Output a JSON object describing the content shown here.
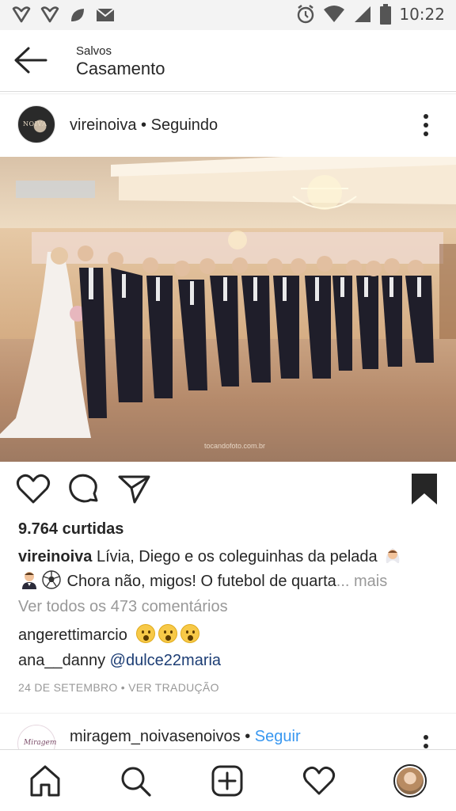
{
  "status_bar": {
    "time": "10:22",
    "left_icons": [
      "heart-outline-icon",
      "heart-outline-icon",
      "leaf-icon",
      "message-icon"
    ],
    "right_icons": [
      "alarm-icon",
      "wifi-icon",
      "signal-icon",
      "battery-icon"
    ]
  },
  "header": {
    "subtitle": "Salvos",
    "title": "Casamento"
  },
  "post": {
    "avatar_text": "NOIVA",
    "username": "vireinoiva",
    "separator": " • ",
    "follow_state": "Seguindo",
    "photo_credit": "tocandofoto.com.br",
    "likes": "9.764 curtidas",
    "caption_user": "vireinoiva",
    "caption_text_1": " Lívia, Diego e os coleguinhas da pelada ",
    "caption_text_2": " Chora não, migos! O futebol de quarta",
    "caption_more": "... mais",
    "view_all_comments": "Ver todos os 473 comentários",
    "comments": [
      {
        "user": "angerettimarcio",
        "text": ""
      },
      {
        "user": "ana__danny",
        "text": "@dulce22maria"
      }
    ],
    "date": "24 DE SETEMBRO",
    "date_sep": " • ",
    "translate": "VER TRADUÇÃO"
  },
  "next_post": {
    "avatar_text": "Miragem",
    "username": "miragem_noivasenoivos",
    "separator": " • ",
    "follow": "Seguir"
  },
  "nav": {
    "items": [
      "home-icon",
      "search-icon",
      "add-post-icon",
      "activity-heart-icon",
      "profile-avatar"
    ]
  },
  "colors": {
    "link_blue": "#3897f0",
    "mention_blue": "#1c3d74",
    "muted_gray": "#999999",
    "text": "#262626"
  }
}
